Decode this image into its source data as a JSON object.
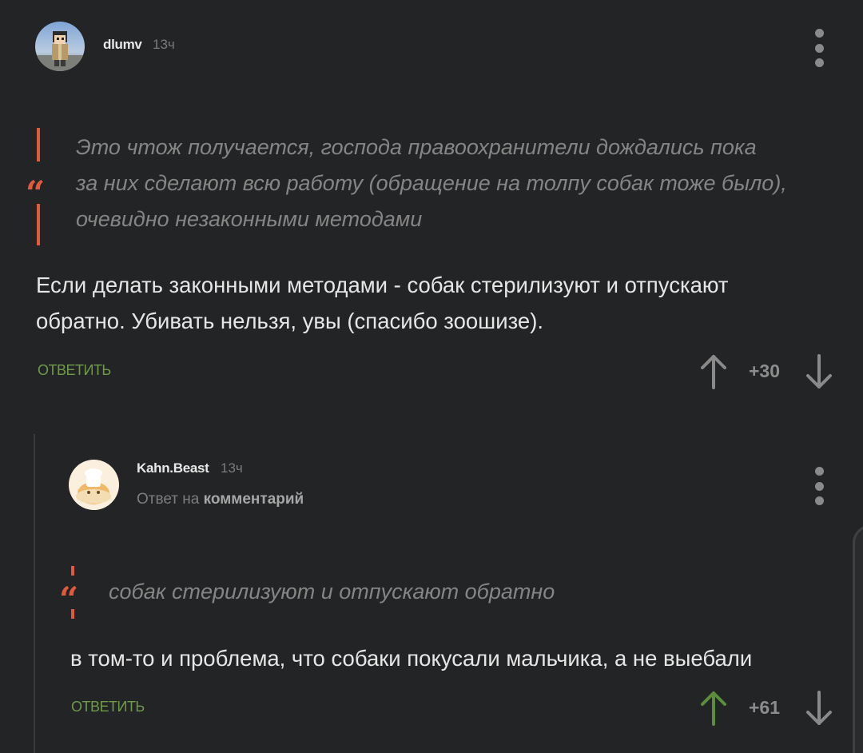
{
  "comment1": {
    "username": "dlumv",
    "time": "13ч",
    "quote_lines": [
      "Это чтож получается, господа правоохранители дождались пока",
      "за них сделают всю работу (обращение на толпу собак тоже было),",
      "очевидно незаконными методами"
    ],
    "body_lines": [
      "Если делать законными методами - собак стерилизуют и отпускают",
      "обратно. Убивать нельзя, увы (спасибо зоошизе)."
    ],
    "reply_label": "ОТВЕТИТЬ",
    "rating": "+30"
  },
  "comment2": {
    "username": "Kahn.Beast",
    "time": "13ч",
    "reply_prefix": "Ответ на",
    "reply_target": "комментарий",
    "quote_lines": [
      "собак стерилизуют и отпускают обратно"
    ],
    "body_lines": [
      "в том-то и проблема, что собаки покусали мальчика, а не выебали"
    ],
    "reply_label": "ОТВЕТИТЬ",
    "rating": "+61"
  },
  "quote_glyph": "“",
  "colors": {
    "background": "#232425",
    "quote_accent": "#e25a3e",
    "reply_green": "#6f9a4a",
    "upvote_active": "#5b8e3c",
    "muted_icon": "#8a8a8a"
  }
}
